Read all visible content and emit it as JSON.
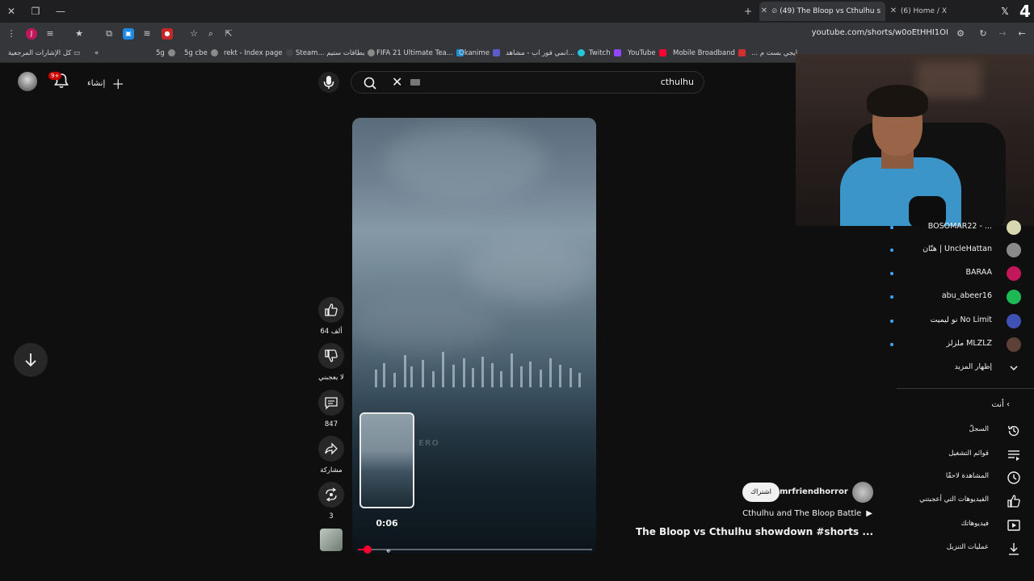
{
  "browser": {
    "tabs": [
      {
        "title": "(49) The Bloop vs Cthulhu s",
        "active": true
      },
      {
        "title": "(6) Home / X",
        "active": false
      }
    ],
    "corner_badge": "4",
    "url": "youtube.com/shorts/w0oEtHHI1OI",
    "bookmarks": [
      "كل الإشارات المرجعية",
      "5g",
      "5g cbe",
      "rekt - Index page",
      "Steam... بطاقات ستيم",
      "FIFA 21 Ultimate Tea...",
      "Okanime",
      "انمي فور اب - مشاهد...",
      "Twitch",
      "YouTube",
      "Mobile Broadband",
      "... ايجي بست م"
    ]
  },
  "header": {
    "notifications_badge": "9+",
    "create_label": "إنشاء",
    "search_query": "cthulhu"
  },
  "short": {
    "watermark": "ERO",
    "timecode": "0:06",
    "progress": 0.04,
    "actions": {
      "likes": "64 ألف",
      "dislike_label": "لا يعجبني",
      "comments": "847",
      "share_label": "مشاركة",
      "remix_count": "3"
    },
    "channel": "@mrfriendhorror",
    "subscribe_label": "اشتراك",
    "playlist": "Cthulhu and The Bloop Battle",
    "title": "The Bloop vs Cthulhu showdown #shorts ..."
  },
  "sidebar": {
    "subscriptions": [
      {
        "name": "BOSOMAR22 - ...",
        "color": "#d8d8b0"
      },
      {
        "name": "هتّان | UncleHattan",
        "color": "#8a8a8a"
      },
      {
        "name": "BARAA",
        "color": "#c2185b"
      },
      {
        "name": "abu_abeer16",
        "color": "#1db954"
      },
      {
        "name": "نو ليميت No Limit",
        "color": "#3f51b5"
      },
      {
        "name": "ملزلز MLZLZ",
        "color": "#5d4037"
      }
    ],
    "show_more": "إظهار المزيد",
    "you_heading": "أنت",
    "nav": [
      {
        "label": "السجلّ",
        "icon": "history-icon"
      },
      {
        "label": "قوائم التشغيل",
        "icon": "playlists-icon"
      },
      {
        "label": "المشاهدة لاحقًا",
        "icon": "watch-later-icon"
      },
      {
        "label": "الفيديوهات التي أعجبتني",
        "icon": "liked-videos-icon"
      },
      {
        "label": "فيديوهاتك",
        "icon": "your-videos-icon"
      },
      {
        "label": "عمليات التنزيل",
        "icon": "downloads-icon"
      }
    ]
  },
  "colors": {
    "accent": "#ff0033",
    "background": "#0f0f0f",
    "link_dot": "#3ea6ff"
  }
}
